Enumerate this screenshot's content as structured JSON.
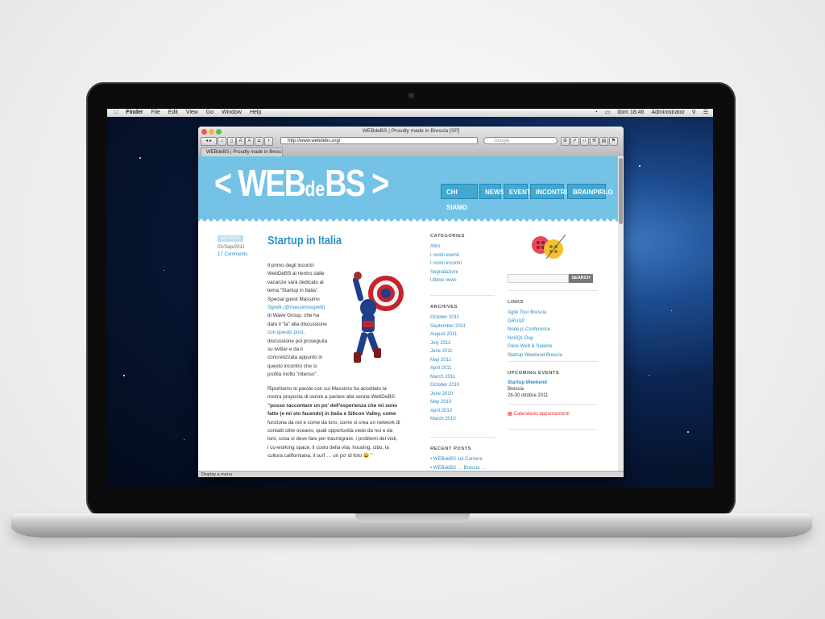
{
  "menubar": {
    "apple_icon": "apple-icon",
    "items": [
      "Finder",
      "File",
      "Edit",
      "View",
      "Go",
      "Window",
      "Help"
    ],
    "clock": "dom 18:46",
    "user": "Administrator"
  },
  "browser": {
    "window_title": "WEBdeBS | Proudly made in Brescia [SP]",
    "address": "http://www.webdebs.org/",
    "search_placeholder": "Google",
    "tab_title": "WEBdeBS | Proudly made in Bresci...",
    "status_text": "Display a menu"
  },
  "site": {
    "logo": {
      "left": "< WEB",
      "de": "de",
      "right": "BS >"
    },
    "nav": [
      "CHI SIAMO",
      "NEWS",
      "EVENTI",
      "INCONTRI",
      "BRAINPIRLO"
    ],
    "accent": "#74c3e6"
  },
  "post": {
    "category": "INCONTRI",
    "date": "01/Sep/2011",
    "comments": "17 Comments",
    "title": "Startup in Italia",
    "para1": [
      "Il primo degli incontri",
      "WebDeBS al rientro dalle",
      "vacanze sarà dedicato al",
      "tema “Startup in Italia”.",
      "Special guest Massimo",
      "Sgrelli (@massimosgrelli)",
      "di Wave Group, che ha",
      "dato il “la” alla discussione",
      "con questo post,",
      "discussione poi proseguita",
      "su twitter e da li",
      "concretizzata appunto in",
      "questo incontro che si",
      "profila molto “intenso”."
    ],
    "para2": [
      "Riportiamo le parole con cui Massimo ha accettato la",
      "nostra proposta di venire a parlare alla serata WebDeBS:",
      "“posso raccontare un po' dell'esperienza che mi sono",
      "fatto (e mi sto facendo) in Italia e Silicon Valley, come",
      "funziona da noi e come da loro, come si crea un network di",
      "contatti oltre oceano, quali opportunità vedo da noi e da",
      "loro, cosa si deve fare per trasmigrare, i problemi dei visti,",
      "i co-working space, il costo della vita, housing, cibo, la",
      "cultura californiana, il surf … un po' di foto 😀 ”"
    ]
  },
  "sidebar1": {
    "categories_title": "CATEGORIES",
    "categories": [
      "Altro",
      "I nostri eventi",
      "I nostri incontri",
      "Segnalazioni",
      "Ultime news"
    ],
    "archives_title": "ARCHIVES",
    "archives": [
      "October 2011",
      "September 2011",
      "August 2011",
      "July 2011",
      "June 2011",
      "May 2011",
      "April 2011",
      "March 2011",
      "October 2010",
      "June 2010",
      "May 2010",
      "April 2010",
      "March 2010"
    ],
    "recent_title": "RECENT POSTS",
    "recent": [
      "WEBdeBS sul Corriere",
      "WEBdeBS … Brescia …"
    ]
  },
  "sidebar2": {
    "search_button": "SEARCH",
    "links_title": "LINKS",
    "links": [
      "Agile Tour Brescia",
      "GRUSP",
      "Node.js Conference",
      "NoSQL Day",
      "Pane Web & Salame",
      "Startup Weekend Brescia"
    ],
    "events_title": "UPCOMING EVENTS",
    "event_name": "Startup Weekend",
    "event_place": "Brescia",
    "event_date": "28-30 ottobre 2011",
    "calendar_link": "Calendario appuntamenti"
  }
}
